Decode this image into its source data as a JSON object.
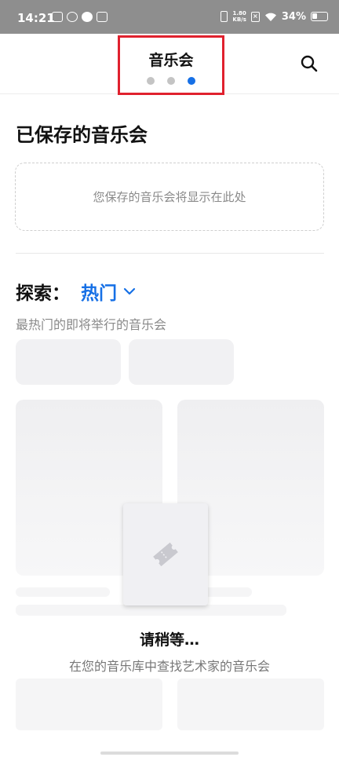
{
  "status_bar": {
    "time": "14:21",
    "net_speed_value": "1.80",
    "net_speed_unit": "KB/s",
    "battery": "34%",
    "battery_level": 0.34
  },
  "header": {
    "title": "音乐会",
    "page_indicator": {
      "count": 3,
      "active_index": 2
    },
    "accent_color": "#1670e6",
    "highlight_color": "#e0212e"
  },
  "saved_section": {
    "title": "已保存的音乐会",
    "empty_text": "您保存的音乐会将显示在此处"
  },
  "explore": {
    "label": "探索：",
    "filter_value": "热门",
    "subtitle": "最热门的即将举行的音乐会"
  },
  "loading": {
    "title": "请稍等…",
    "subtitle": "在您的音乐库中查找艺术家的音乐会"
  },
  "icons": {
    "search": "search-icon",
    "dropdown": "chevron-down-icon",
    "ticket": "ticket-icon"
  }
}
